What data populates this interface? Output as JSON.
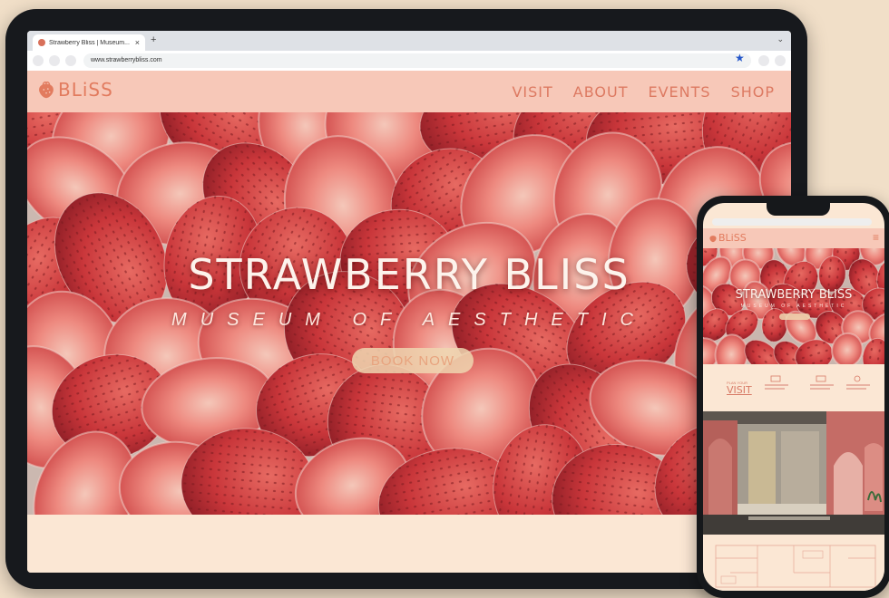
{
  "browser": {
    "tab_title": "Strawberry Bliss | Museum...",
    "tab_close": "×",
    "new_tab": "+",
    "tab_menu": "⌄",
    "url": "www.strawberrybliss.com",
    "bookmark_icon": "star-icon"
  },
  "site": {
    "logo_text": "BLiSS",
    "nav": [
      "VISIT",
      "ABOUT",
      "EVENTS",
      "SHOP"
    ],
    "hero_title": "STRAWBERRY BLISS",
    "hero_subtitle": "MUSEUM OF AESTHETIC",
    "cta_label": "BOOK NOW"
  },
  "mobile": {
    "logo_text": "BLiSS",
    "menu_icon": "≡",
    "hero_title": "STRAWBERRY BLISS",
    "hero_subtitle": "MUSEUM OF AESTHETIC",
    "plan_label": "PLAN YOUR",
    "plan_title": "VISIT"
  },
  "colors": {
    "header": "#f7c8b8",
    "accent": "#e27b5e",
    "page_bg": "#fbe7d4",
    "strawberry": "#d4413e"
  }
}
